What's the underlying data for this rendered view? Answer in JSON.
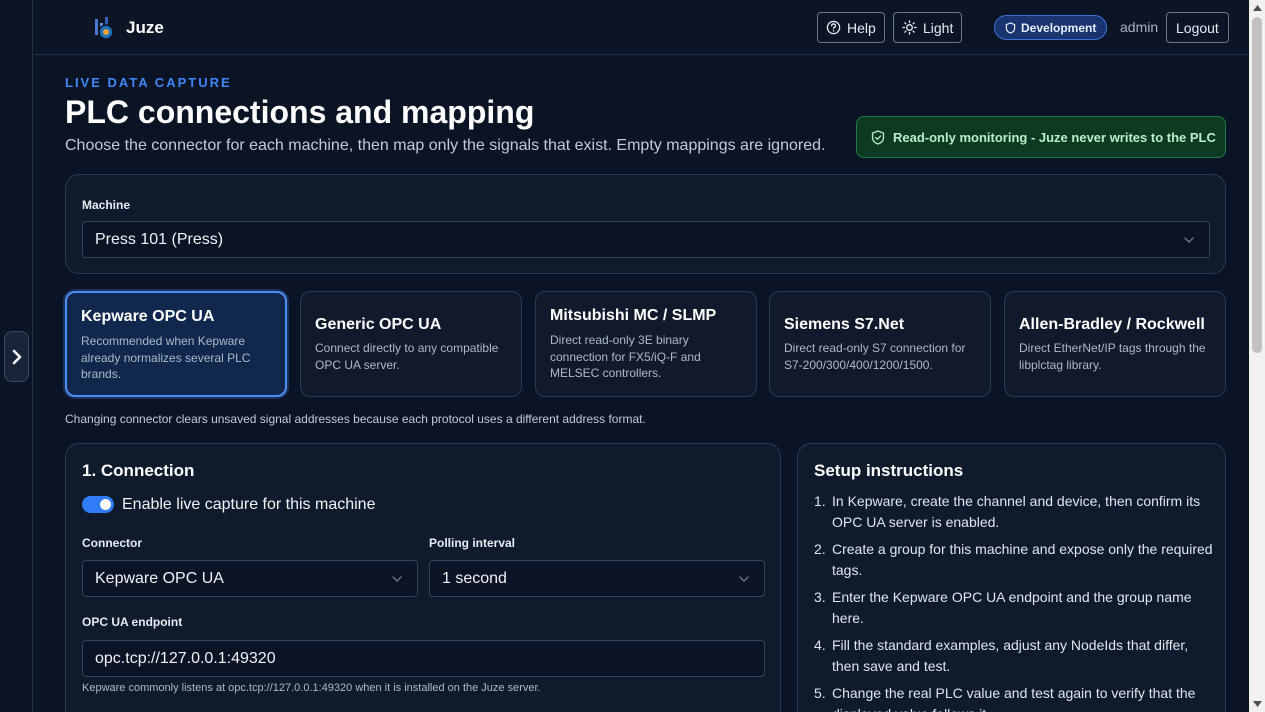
{
  "brand": {
    "name": "Juze"
  },
  "header": {
    "help_label": "Help",
    "theme_label": "Light",
    "environment_badge": "Development",
    "user_name": "admin",
    "logout_label": "Logout"
  },
  "page": {
    "eyebrow": "LIVE DATA CAPTURE",
    "title": "PLC connections and mapping",
    "subtitle": "Choose the connector for each machine, then map only the signals that exist. Empty mappings are ignored.",
    "readonly_notice": "Read-only monitoring - Juze never writes to the PLC"
  },
  "machine": {
    "label": "Machine",
    "selected": "Press 101 (Press)"
  },
  "connectors": [
    {
      "title": "Kepware OPC UA",
      "description": "Recommended when Kepware already normalizes several PLC brands.",
      "selected": true
    },
    {
      "title": "Generic OPC UA",
      "description": "Connect directly to any compatible OPC UA server.",
      "selected": false
    },
    {
      "title": "Mitsubishi MC / SLMP",
      "description": "Direct read-only 3E binary connection for FX5/iQ-F and MELSEC controllers.",
      "selected": false
    },
    {
      "title": "Siemens S7.Net",
      "description": "Direct read-only S7 connection for S7-200/300/400/1200/1500.",
      "selected": false
    },
    {
      "title": "Allen-Bradley / Rockwell",
      "description": "Direct EtherNet/IP tags through the libplctag library.",
      "selected": false
    }
  ],
  "connector_hint": "Changing connector clears unsaved signal addresses because each protocol uses a different address format.",
  "connection": {
    "title": "1. Connection",
    "enable_label": "Enable live capture for this machine",
    "enabled": true,
    "connector_label": "Connector",
    "connector_value": "Kepware OPC UA",
    "polling_label": "Polling interval",
    "polling_value": "1 second",
    "endpoint_label": "OPC UA endpoint",
    "endpoint_value": "opc.tcp://127.0.0.1:49320",
    "endpoint_help": "Kepware commonly listens at opc.tcp://127.0.0.1:49320 when it is installed on the Juze server."
  },
  "setup": {
    "title": "Setup instructions",
    "steps": [
      {
        "num": "1.",
        "text": "In Kepware, create the channel and device, then confirm its OPC UA server is enabled."
      },
      {
        "num": "2.",
        "text": "Create a group for this machine and expose only the required tags."
      },
      {
        "num": "3.",
        "text": "Enter the Kepware OPC UA endpoint and the group name here."
      },
      {
        "num": "4.",
        "text": "Fill the standard examples, adjust any NodeIds that differ, then save and test."
      },
      {
        "num": "5.",
        "text": "Change the real PLC value and test again to verify that the displayed value follows it."
      }
    ]
  },
  "colors": {
    "accent": "#3f86f7",
    "background": "#0b1424",
    "success": "#1f7a44"
  }
}
